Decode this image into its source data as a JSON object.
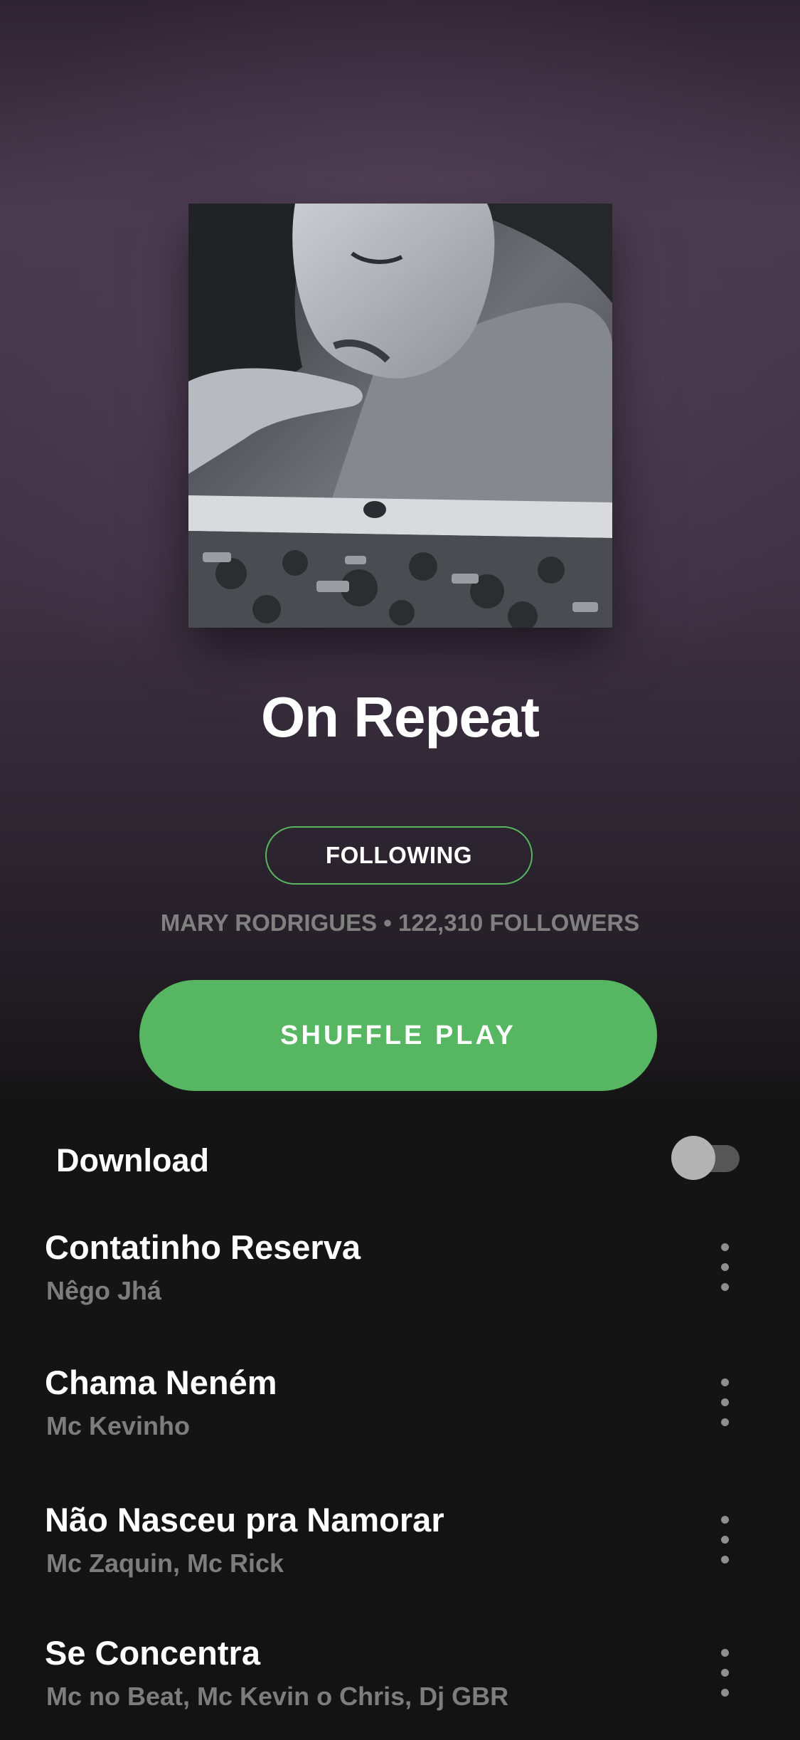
{
  "playlist": {
    "title": "On Repeat",
    "follow_button": "FOLLOWING",
    "owner_line": "MARY RODRIGUES • 122,310 FOLLOWERS",
    "shuffle_button": "SHUFFLE PLAY"
  },
  "download": {
    "label": "Download",
    "enabled": false
  },
  "tracks": [
    {
      "title": "Contatinho Reserva",
      "artist": "Nêgo Jhá"
    },
    {
      "title": "Chama Neném",
      "artist": "Mc Kevinho"
    },
    {
      "title": "Não Nasceu pra Namorar",
      "artist": "Mc Zaquin, Mc Rick"
    },
    {
      "title": "Se Concentra",
      "artist": "Mc no Beat, Mc Kevin o Chris, Dj GBR"
    }
  ],
  "colors": {
    "accent_green": "#57b661",
    "background": "#131313"
  },
  "icons": {
    "track_menu": "more-vertical-icon"
  }
}
